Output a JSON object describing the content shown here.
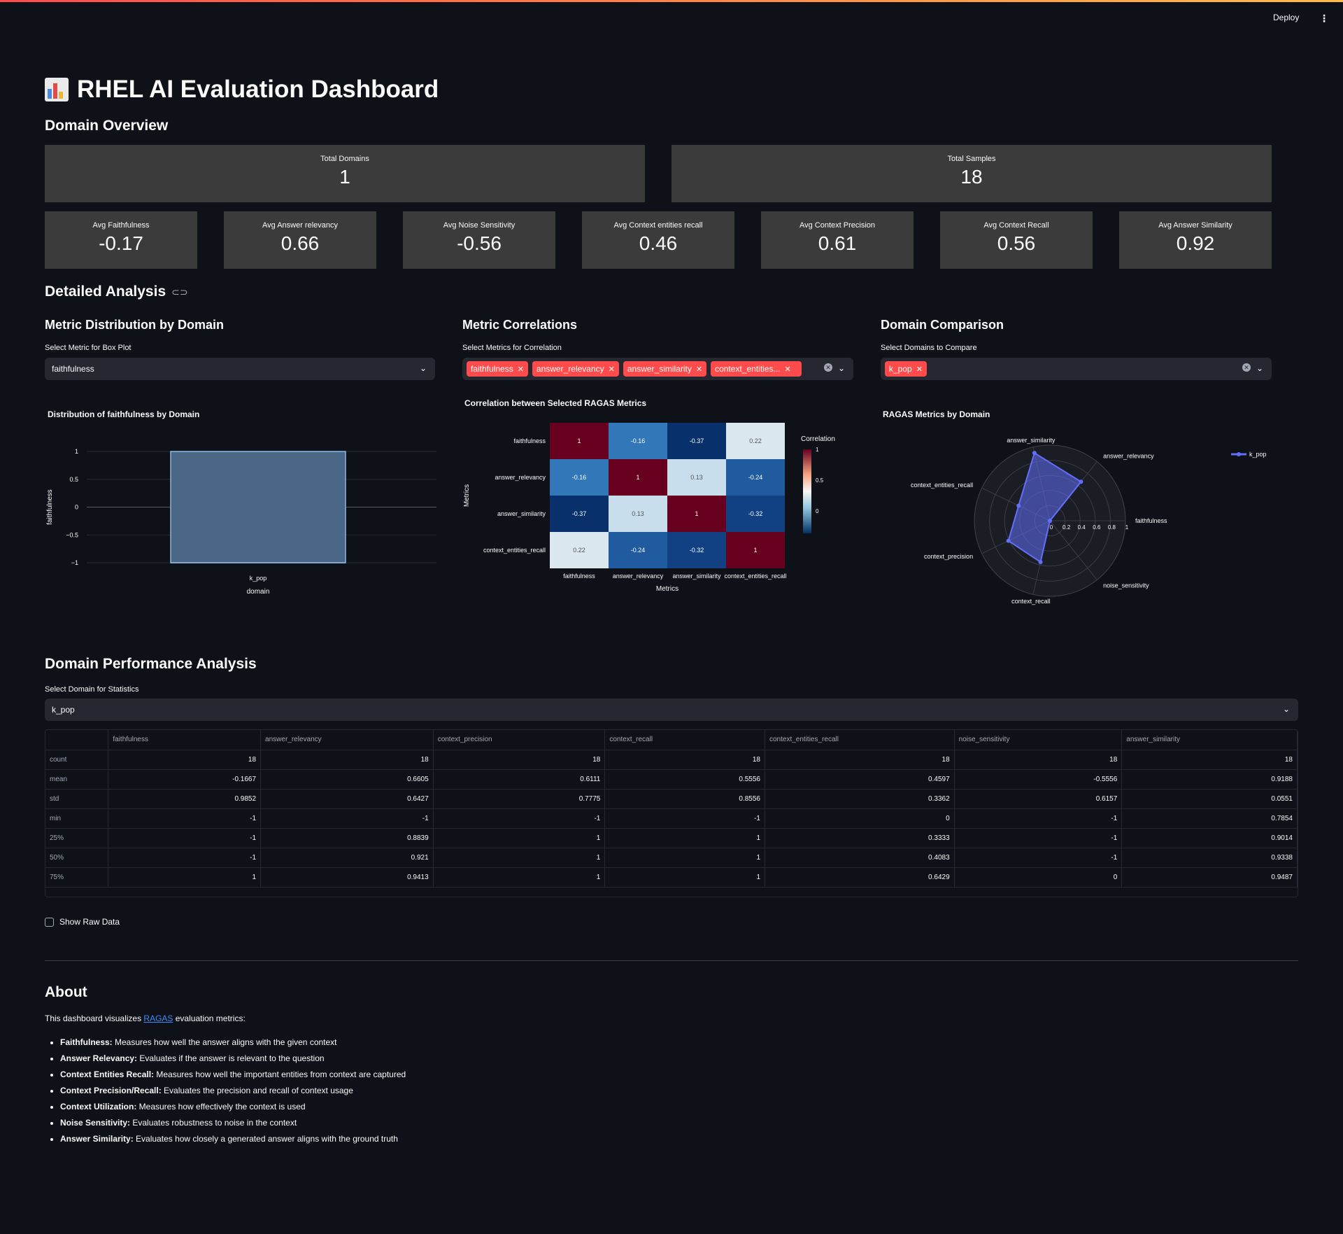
{
  "topbar": {
    "deploy_label": "Deploy",
    "menu_icon": "⋮"
  },
  "title": "RHEL AI Evaluation Dashboard",
  "domain_overview": {
    "heading": "Domain Overview",
    "top_metrics": [
      {
        "label": "Total Domains",
        "value": "1"
      },
      {
        "label": "Total Samples",
        "value": "18"
      }
    ],
    "avg_metrics": [
      {
        "label": "Avg Faithfulness",
        "value": "-0.17"
      },
      {
        "label": "Avg Answer relevancy",
        "value": "0.66"
      },
      {
        "label": "Avg Noise Sensitivity",
        "value": "-0.56"
      },
      {
        "label": "Avg Context entities recall",
        "value": "0.46"
      },
      {
        "label": "Avg Context Precision",
        "value": "0.61"
      },
      {
        "label": "Avg Context Recall",
        "value": "0.56"
      },
      {
        "label": "Avg Answer Similarity",
        "value": "0.92"
      }
    ]
  },
  "detailed_analysis": {
    "heading": "Detailed Analysis",
    "link_icon": "link-icon",
    "distribution": {
      "heading": "Metric Distribution by Domain",
      "select_label": "Select Metric for Box Plot",
      "select_value": "faithfulness"
    },
    "correlations": {
      "heading": "Metric Correlations",
      "select_label": "Select Metrics for Correlation",
      "tags": [
        "faithfulness",
        "answer_relevancy",
        "answer_similarity",
        "context_entities..."
      ]
    },
    "comparison": {
      "heading": "Domain Comparison",
      "select_label": "Select Domains to Compare",
      "tags": [
        "k_pop"
      ]
    }
  },
  "chart_data": [
    {
      "type": "box",
      "title": "Distribution of faithfulness by Domain",
      "xlabel": "domain",
      "ylabel": "faithfulness",
      "categories": [
        "k_pop"
      ],
      "box": {
        "min": -1,
        "q1": -1,
        "median": -1,
        "q3": 1,
        "max": 1
      },
      "yticks": [
        "1",
        "0.5",
        "0",
        "−0.5",
        "−1"
      ],
      "ylim": [
        -1,
        1
      ]
    },
    {
      "type": "heatmap",
      "title": "Correlation between Selected RAGAS Metrics",
      "xlabel": "Metrics",
      "ylabel": "Metrics",
      "labels": [
        "faithfulness",
        "answer_relevancy",
        "answer_similarity",
        "context_entities_recall"
      ],
      "matrix": [
        [
          1,
          -0.16,
          -0.37,
          0.22
        ],
        [
          -0.16,
          1,
          0.13,
          -0.24
        ],
        [
          -0.37,
          0.13,
          1,
          -0.32
        ],
        [
          0.22,
          -0.24,
          -0.32,
          1
        ]
      ],
      "colorbar_title": "Correlation",
      "colorbar_ticks": [
        "1",
        "0.5",
        "0"
      ]
    },
    {
      "type": "radar",
      "title": "RAGAS Metrics by Domain",
      "axes": [
        "faithfulness",
        "answer_relevancy",
        "answer_similarity",
        "context_entities_recall",
        "context_precision",
        "context_recall",
        "noise_sensitivity"
      ],
      "radial_ticks": [
        "0",
        "0.2",
        "0.4",
        "0.6",
        "0.8",
        "1"
      ],
      "series": [
        {
          "name": "k_pop",
          "values": [
            -0.17,
            0.66,
            0.92,
            0.46,
            0.61,
            0.56,
            -0.56
          ],
          "color": "#636efa"
        }
      ]
    }
  ],
  "performance": {
    "heading": "Domain Performance Analysis",
    "select_label": "Select Domain for Statistics",
    "select_value": "k_pop",
    "columns": [
      "faithfulness",
      "answer_relevancy",
      "context_precision",
      "context_recall",
      "context_entities_recall",
      "noise_sensitivity",
      "answer_similarity"
    ],
    "rows": [
      {
        "label": "count",
        "values": [
          "18",
          "18",
          "18",
          "18",
          "18",
          "18",
          "18"
        ]
      },
      {
        "label": "mean",
        "values": [
          "-0.1667",
          "0.6605",
          "0.6111",
          "0.5556",
          "0.4597",
          "-0.5556",
          "0.9188"
        ]
      },
      {
        "label": "std",
        "values": [
          "0.9852",
          "0.6427",
          "0.7775",
          "0.8556",
          "0.3362",
          "0.6157",
          "0.0551"
        ]
      },
      {
        "label": "min",
        "values": [
          "-1",
          "-1",
          "-1",
          "-1",
          "0",
          "-1",
          "0.7854"
        ]
      },
      {
        "label": "25%",
        "values": [
          "-1",
          "0.8839",
          "1",
          "1",
          "0.3333",
          "-1",
          "0.9014"
        ]
      },
      {
        "label": "50%",
        "values": [
          "-1",
          "0.921",
          "1",
          "1",
          "0.4083",
          "-1",
          "0.9338"
        ]
      },
      {
        "label": "75%",
        "values": [
          "1",
          "0.9413",
          "1",
          "1",
          "0.6429",
          "0",
          "0.9487"
        ]
      }
    ],
    "show_raw_label": "Show Raw Data"
  },
  "about": {
    "heading": "About",
    "intro_pre": "This dashboard visualizes ",
    "intro_link": "RAGAS",
    "intro_post": " evaluation metrics:",
    "items": [
      {
        "term": "Faithfulness:",
        "desc": " Measures how well the answer aligns with the given context"
      },
      {
        "term": "Answer Relevancy:",
        "desc": " Evaluates if the answer is relevant to the question"
      },
      {
        "term": "Context Entities Recall:",
        "desc": " Measures how well the important entities from context are captured"
      },
      {
        "term": "Context Precision/Recall:",
        "desc": " Evaluates the precision and recall of context usage"
      },
      {
        "term": "Context Utilization:",
        "desc": " Measures how effectively the context is used"
      },
      {
        "term": "Noise Sensitivity:",
        "desc": " Evaluates robustness to noise in the context"
      },
      {
        "term": "Answer Similarity:",
        "desc": " Evaluates how closely a generated answer aligns with the ground truth"
      }
    ]
  }
}
